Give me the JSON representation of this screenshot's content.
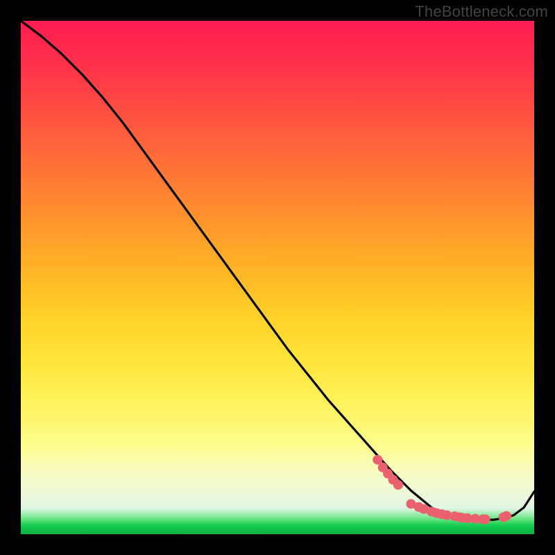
{
  "watermark": "TheBottleneck.com",
  "chart_data": {
    "type": "line",
    "title": "",
    "xlabel": "",
    "ylabel": "",
    "xlim": [
      0,
      100
    ],
    "ylim": [
      0,
      100
    ],
    "series": [
      {
        "name": "bottleneck-curve",
        "x": [
          0,
          4,
          8,
          12,
          16,
          20,
          24,
          28,
          32,
          36,
          40,
          44,
          48,
          52,
          56,
          60,
          64,
          68,
          72,
          76,
          80,
          82,
          83,
          84,
          86,
          88,
          90,
          92,
          94,
          96,
          98,
          100
        ],
        "values": [
          100,
          97,
          93.5,
          89.5,
          85,
          80,
          74.5,
          69,
          63.5,
          58,
          52.5,
          47,
          41.5,
          36,
          31,
          26,
          21.5,
          17,
          12.5,
          8.5,
          5.2,
          4.2,
          3.9,
          3.6,
          3.2,
          2.9,
          2.8,
          2.8,
          3.1,
          3.7,
          5.2,
          8.3
        ]
      }
    ],
    "markers": {
      "name": "data-points",
      "color": "#e9606e",
      "radius_px": 7,
      "points_xy": [
        [
          69.5,
          14.5
        ],
        [
          70.5,
          13.0
        ],
        [
          71.5,
          11.8
        ],
        [
          72.5,
          10.6
        ],
        [
          73.5,
          9.6
        ],
        [
          76.0,
          5.9
        ],
        [
          77.5,
          5.3
        ],
        [
          78.5,
          4.9
        ],
        [
          80.0,
          4.4
        ],
        [
          81.0,
          4.1
        ],
        [
          82.0,
          3.9
        ],
        [
          83.0,
          3.7
        ],
        [
          84.5,
          3.5
        ],
        [
          85.5,
          3.3
        ],
        [
          86.0,
          3.2
        ],
        [
          87.0,
          3.1
        ],
        [
          88.5,
          3.0
        ],
        [
          90.0,
          2.9
        ],
        [
          90.5,
          2.9
        ],
        [
          94.0,
          3.3
        ],
        [
          94.6,
          3.55
        ]
      ]
    },
    "colors": {
      "curve": "#000000",
      "marker": "#e9606e",
      "frame_bg": "#000000"
    }
  }
}
